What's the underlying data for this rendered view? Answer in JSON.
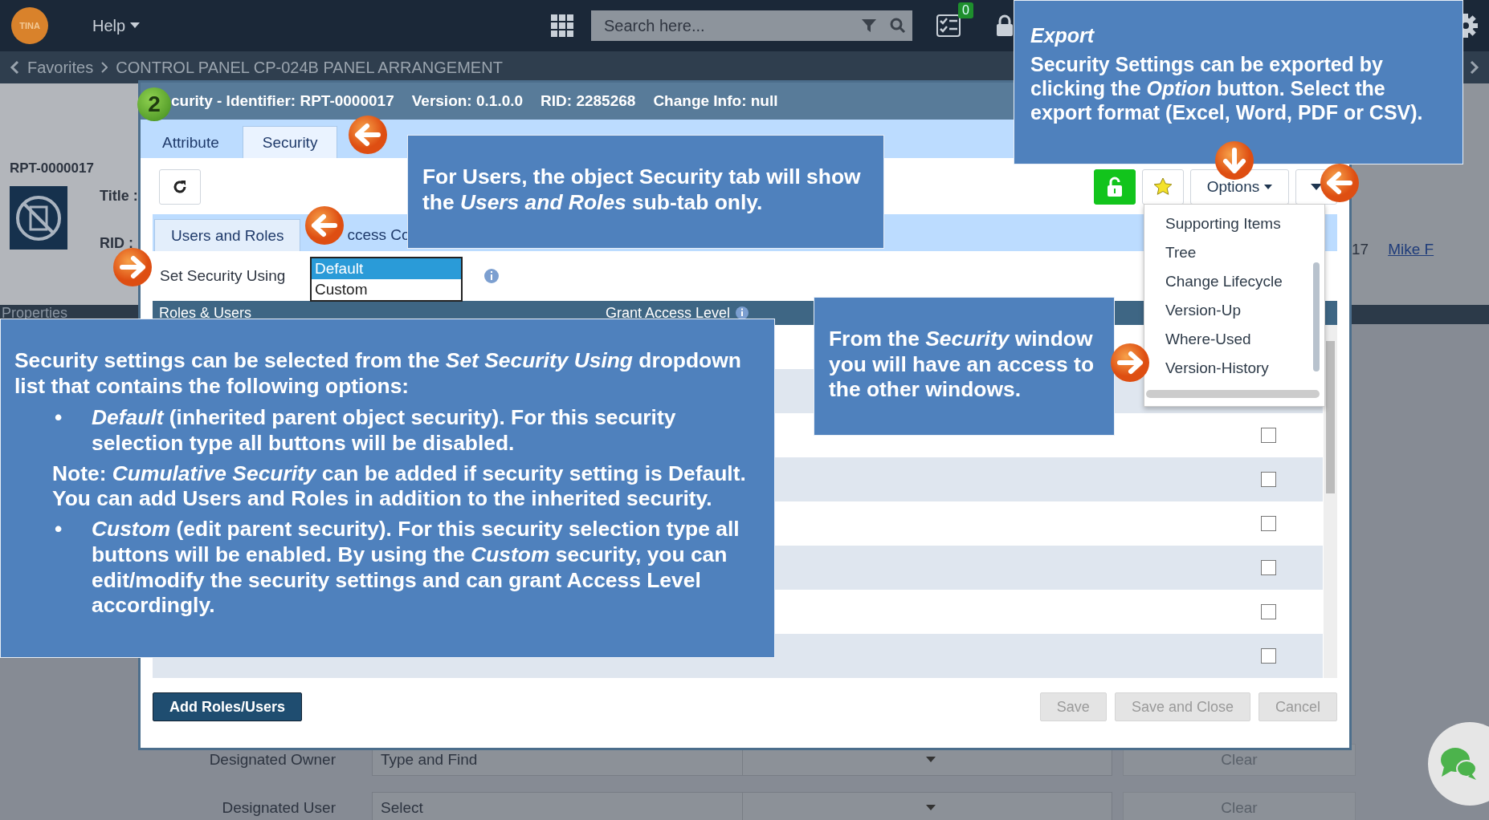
{
  "top_bar": {
    "logo": "TINA",
    "help": "Help",
    "search": {
      "placeholder": "Search here..."
    },
    "tasks_badge": "0"
  },
  "breadcrumb": [
    "Favorites",
    "CONTROL PANEL CP-024B PANEL ARRANGEMENT"
  ],
  "background_page": {
    "identifier": "RPT-0000017",
    "title_label": "Title :",
    "rid_label": "RID :",
    "properties": "Properties",
    "date_fragment": "17",
    "user_link": "Mike F",
    "fields": [
      {
        "label": "Designated Owner",
        "placeholder": "Type and Find",
        "clear": "Clear"
      },
      {
        "label": "Designated User",
        "value": "Select",
        "clear": "Clear"
      }
    ]
  },
  "dialog": {
    "step": "2",
    "title_parts": [
      "curity - Identifier: RPT-0000017",
      "Version: 0.1.0.0",
      "RID: 2285268",
      "Change Info: null"
    ],
    "tabs": [
      {
        "label": "Attribute",
        "selected": false
      },
      {
        "label": "Security",
        "selected": true
      }
    ],
    "options_button": "Options",
    "options_menu": [
      "Supporting Items",
      "Tree",
      "Change Lifecycle",
      "Version-Up",
      "Where-Used",
      "Version-History"
    ],
    "sub_tabs": [
      {
        "label": "Users and Roles",
        "selected": true
      },
      {
        "label": "ccess Co",
        "selected": false
      }
    ],
    "set_security": {
      "label": "Set Security Using",
      "options": [
        {
          "label": "Default",
          "selected": true
        },
        {
          "label": "Custom",
          "selected": false
        }
      ]
    },
    "table": {
      "columns": [
        "Roles & Users",
        "Grant Access Level"
      ],
      "rows": [
        {
          "checked": false
        },
        {
          "checked": false
        },
        {
          "checked": false
        },
        {
          "checked": false
        },
        {
          "checked": false
        },
        {
          "checked": false
        }
      ]
    },
    "buttons": [
      {
        "label": "Add Roles/Users",
        "kind": "primary"
      },
      {
        "label": "Save",
        "kind": "disabled"
      },
      {
        "label": "Save and Close",
        "kind": "disabled"
      },
      {
        "label": "Cancel",
        "kind": "disabled"
      }
    ]
  },
  "callouts": [
    {
      "paragraphs": [
        {
          "kind": "para",
          "text": "For Users, the object Security tab will show the *Users and Roles* sub-tab only."
        }
      ]
    },
    {
      "paragraphs": [
        {
          "kind": "title",
          "text": "Export"
        },
        {
          "kind": "para",
          "text": "Security Settings can be exported by clicking the *Option* button. Select the export format (Excel, Word, PDF or CSV)."
        }
      ]
    },
    {
      "paragraphs": [
        {
          "kind": "para",
          "text": "Security settings can be selected from the *Set Security Using* dropdown list that contains the following options:"
        },
        {
          "kind": "bullet",
          "marker": "•",
          "text": "*Default* (inherited parent object security). For this security selection type all buttons will be disabled."
        },
        {
          "kind": "note",
          "text": "Note: *Cumulative Security* can be added if security setting is Default. You can add Users and Roles in addition to the inherited security."
        },
        {
          "kind": "bullet",
          "marker": "•",
          "text": "*Custom* (edit parent security). For this security selection type all buttons will be enabled. By using the *Custom* security, you can edit/modify the security settings and can grant Access Level accordingly."
        }
      ]
    },
    {
      "paragraphs": [
        {
          "kind": "para",
          "text": "From the *Security* window you will have an access to the other windows."
        }
      ]
    }
  ]
}
